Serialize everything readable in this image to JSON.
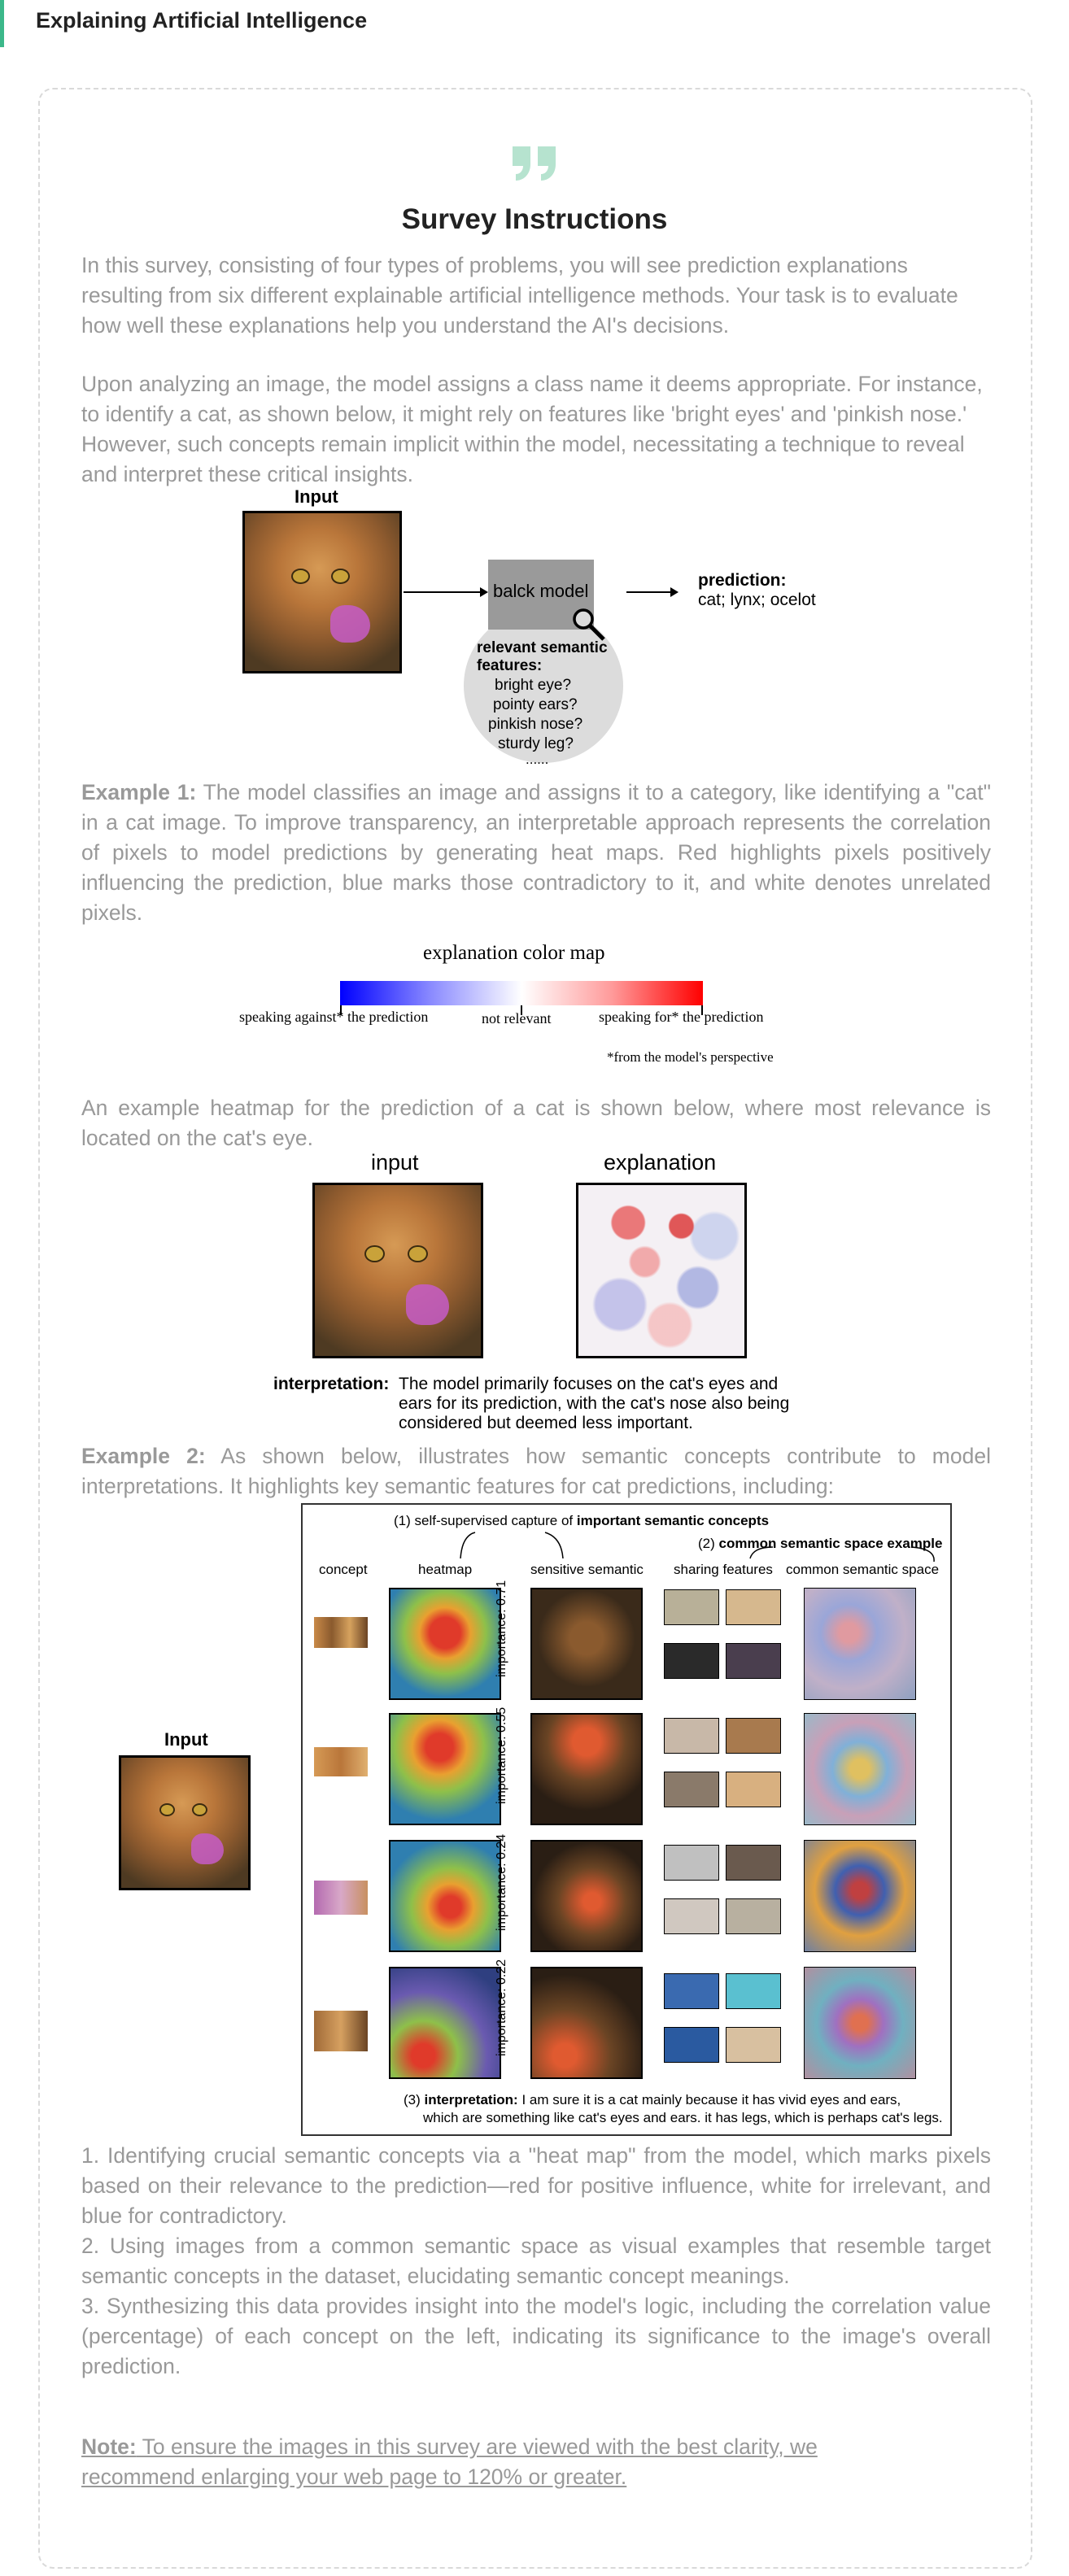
{
  "app": {
    "title": "Explaining Artificial Intelligence",
    "accent_color": "#3cb88a"
  },
  "survey": {
    "title": "Survey Instructions",
    "intro": "In this survey, consisting of four types of problems, you will see prediction explanations resulting from six different explainable artificial intelligence methods. Your task is to evaluate how well these explanations help you understand the AI's decisions.",
    "analysis": "Upon analyzing an image, the model assigns a class name it deems appropriate. For instance, to identify a cat, as shown below, it might rely on features like 'bright eyes' and 'pinkish nose.' However, such concepts remain implicit within the model, necessitating a technique to reveal and interpret these critical insights."
  },
  "figure1": {
    "input_label": "Input",
    "model_label": "balck model",
    "prediction_label": "prediction:",
    "prediction_value": "cat; lynx; ocelot",
    "features_title": "relevant semantic features:",
    "features": [
      "bright eye?",
      "pointy ears?",
      "pinkish nose?",
      "sturdy leg?",
      "......"
    ]
  },
  "example1": {
    "label": "Example 1:",
    "text": " The model classifies an image and assigns it to a category, like identifying a \"cat\" in a cat image. To improve transparency, an interpretable approach represents the correlation of pixels to model predictions by generating heat maps. Red highlights pixels positively influencing the prediction, blue marks those contradictory to it, and white denotes unrelated pixels."
  },
  "colormap": {
    "title": "explanation color map",
    "left": "speaking against* the prediction",
    "middle": "not relevant",
    "right": "speaking for* the prediction",
    "footnote": "*from the model's perspective"
  },
  "heatmap_intro": "An example heatmap for the prediction of a cat is shown below, where most relevance is located on the cat's eye.",
  "figure2": {
    "input_label": "input",
    "explanation_label": "explanation",
    "interp_label": "interpretation:",
    "interp_lines": [
      "The model primarily focuses on the cat's eyes and",
      "ears for its prediction, with the cat's nose also being",
      "considered but deemed less important."
    ]
  },
  "example2": {
    "label": "Example 2:",
    "text": " As shown below, illustrates how semantic concepts contribute to model interpretations. It highlights key semantic features for cat predictions, including:"
  },
  "figure3": {
    "input_label": "Input",
    "caption1_prefix": "(1) self-supervised capture of ",
    "caption1_bold": "important semantic concepts",
    "caption2_prefix": "(2) ",
    "caption2_bold": "common semantic space example",
    "columns": [
      "concept",
      "heatmap",
      "sensitive semantic",
      "sharing features",
      "common semantic space"
    ],
    "importances": [
      "importance: 0.71",
      "importance: 0.55",
      "importance: 0.24",
      "importance: 0.22"
    ],
    "caption3_prefix": "(3) ",
    "caption3_bold": "interpretation:",
    "caption3_line1": " I am sure it is a cat mainly because it has vivid eyes and ears,",
    "caption3_line2": "which are something like cat's eyes and ears. it has legs, which is perhaps cat's legs."
  },
  "steps": [
    "1. Identifying crucial semantic concepts via a \"heat map\" from the model, which marks pixels based on their relevance to the prediction—red for positive influence, white for irrelevant, and blue for contradictory.",
    "2. Using images from a common semantic space as visual examples that resemble target semantic concepts in the dataset, elucidating semantic concept meanings.",
    "3. Synthesizing this data provides insight into the model's logic, including the correlation value (percentage) of each concept on the left, indicating its significance to the image's overall prediction."
  ],
  "note": {
    "label": "Note:",
    "text": " To ensure the images in this survey are viewed with the best clarity, we recommend enlarging your web page to 120% or greater."
  }
}
